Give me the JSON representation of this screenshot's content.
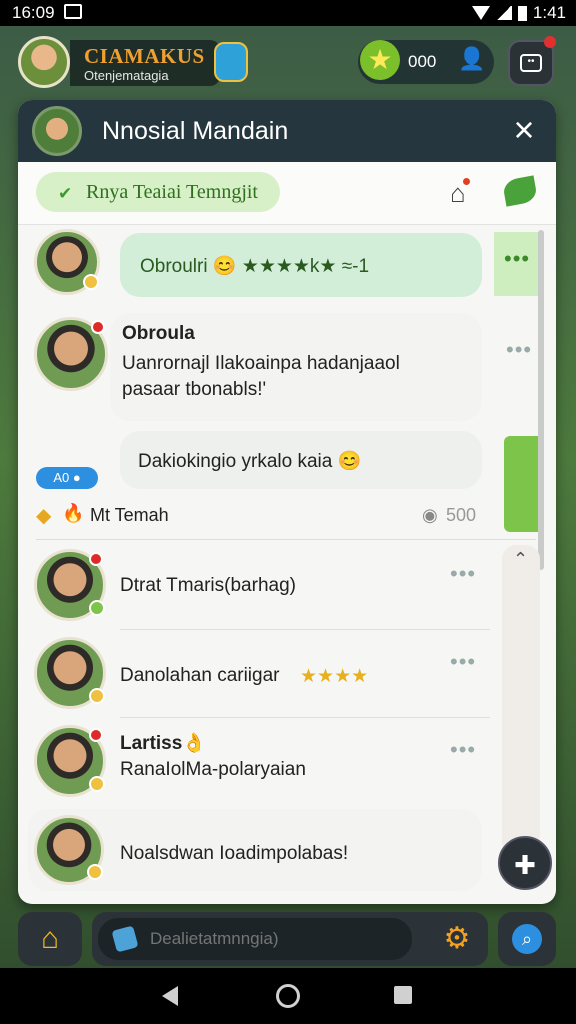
{
  "status_bar": {
    "time_left": "16:09",
    "time_right": "1:41"
  },
  "header": {
    "player_name": "CIAMAKUS",
    "player_sub": "Otenjematagia",
    "coin_count": "000"
  },
  "panel": {
    "title": "Nnosial Mandain",
    "close_icon": "×",
    "tag_label": "Rnya Teaiai Temngjit"
  },
  "messages": [
    {
      "text": "Obroulri 😊 ★★★★k★ ≈-1"
    },
    {
      "name": "Obroula",
      "line1": "Uanrornajl Ilakoainpa hadanjaaol",
      "line2": "pasaar tbonabls!'"
    },
    {
      "text": "Dakiokingio yrkalo kaia 😊"
    }
  ],
  "badge": "A0 ●",
  "section": {
    "label": "Mt Temah",
    "count": "500"
  },
  "friends": [
    {
      "text": "Dtrat Tmaris(barhag)"
    },
    {
      "text": "Danolahan cariigar",
      "stars": "★★★★"
    },
    {
      "name": "Lartiss👌",
      "text": "RanaIolMa-polaryaian"
    },
    {
      "text": "Noalsdwan Ioadimpolabas!"
    }
  ],
  "bottom": {
    "input_placeholder": "Dealietatmnngia)"
  },
  "more_label": "•••"
}
